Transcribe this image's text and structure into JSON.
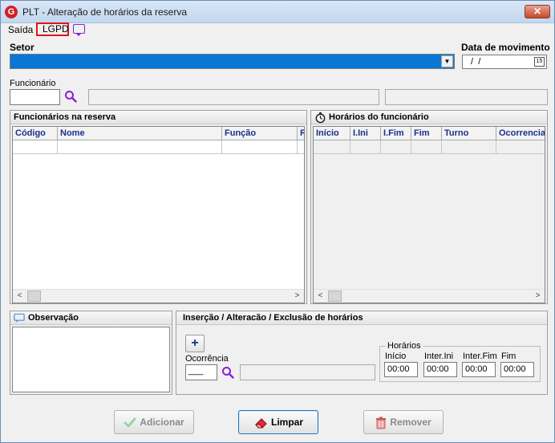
{
  "window": {
    "title": "PLT - Alteração de horários da reserva",
    "app_icon_letter": "G",
    "close_glyph": "✕"
  },
  "menu": {
    "items": [
      {
        "label": "Saída"
      },
      {
        "label": "LGPD"
      }
    ]
  },
  "setor": {
    "label": "Setor",
    "dropdown_glyph": "▼"
  },
  "data_movimento": {
    "label": "Data de movimento",
    "value": " /  /",
    "calendar_glyph": "15"
  },
  "funcionario": {
    "label": "Funcionário"
  },
  "reserva_panel": {
    "title": "Funcionários na reserva",
    "columns": [
      "Código",
      "Nome",
      "Função",
      "R"
    ]
  },
  "horarios_panel": {
    "title": "Horários do funcionário",
    "columns": [
      "Início",
      "I.Ini",
      "I.Fim",
      "Fim",
      "Turno",
      "Ocorrencia"
    ]
  },
  "observacao": {
    "title": "Observação"
  },
  "insercao": {
    "title": "Inserção / Alteracão / Exclusão de horários",
    "plus_label": "+",
    "ocorrencia_label": "Ocorrência",
    "ocorrencia_value": "___",
    "horarios_legend": "Horários",
    "fields": [
      {
        "label": "Início",
        "value": "00:00"
      },
      {
        "label": "Inter.Ini",
        "value": "00:00"
      },
      {
        "label": "Inter.Fim",
        "value": "00:00"
      },
      {
        "label": "Fim",
        "value": "00:00"
      }
    ]
  },
  "buttons": {
    "adicionar": "Adicionar",
    "limpar": "Limpar",
    "remover": "Remover"
  },
  "scroll": {
    "left": "<",
    "right": ">"
  },
  "colors": {
    "accent": "#0a77d6",
    "header_text": "#1a2e8c",
    "highlight": "#e0141e",
    "icon_purple": "#8b1fd1"
  }
}
